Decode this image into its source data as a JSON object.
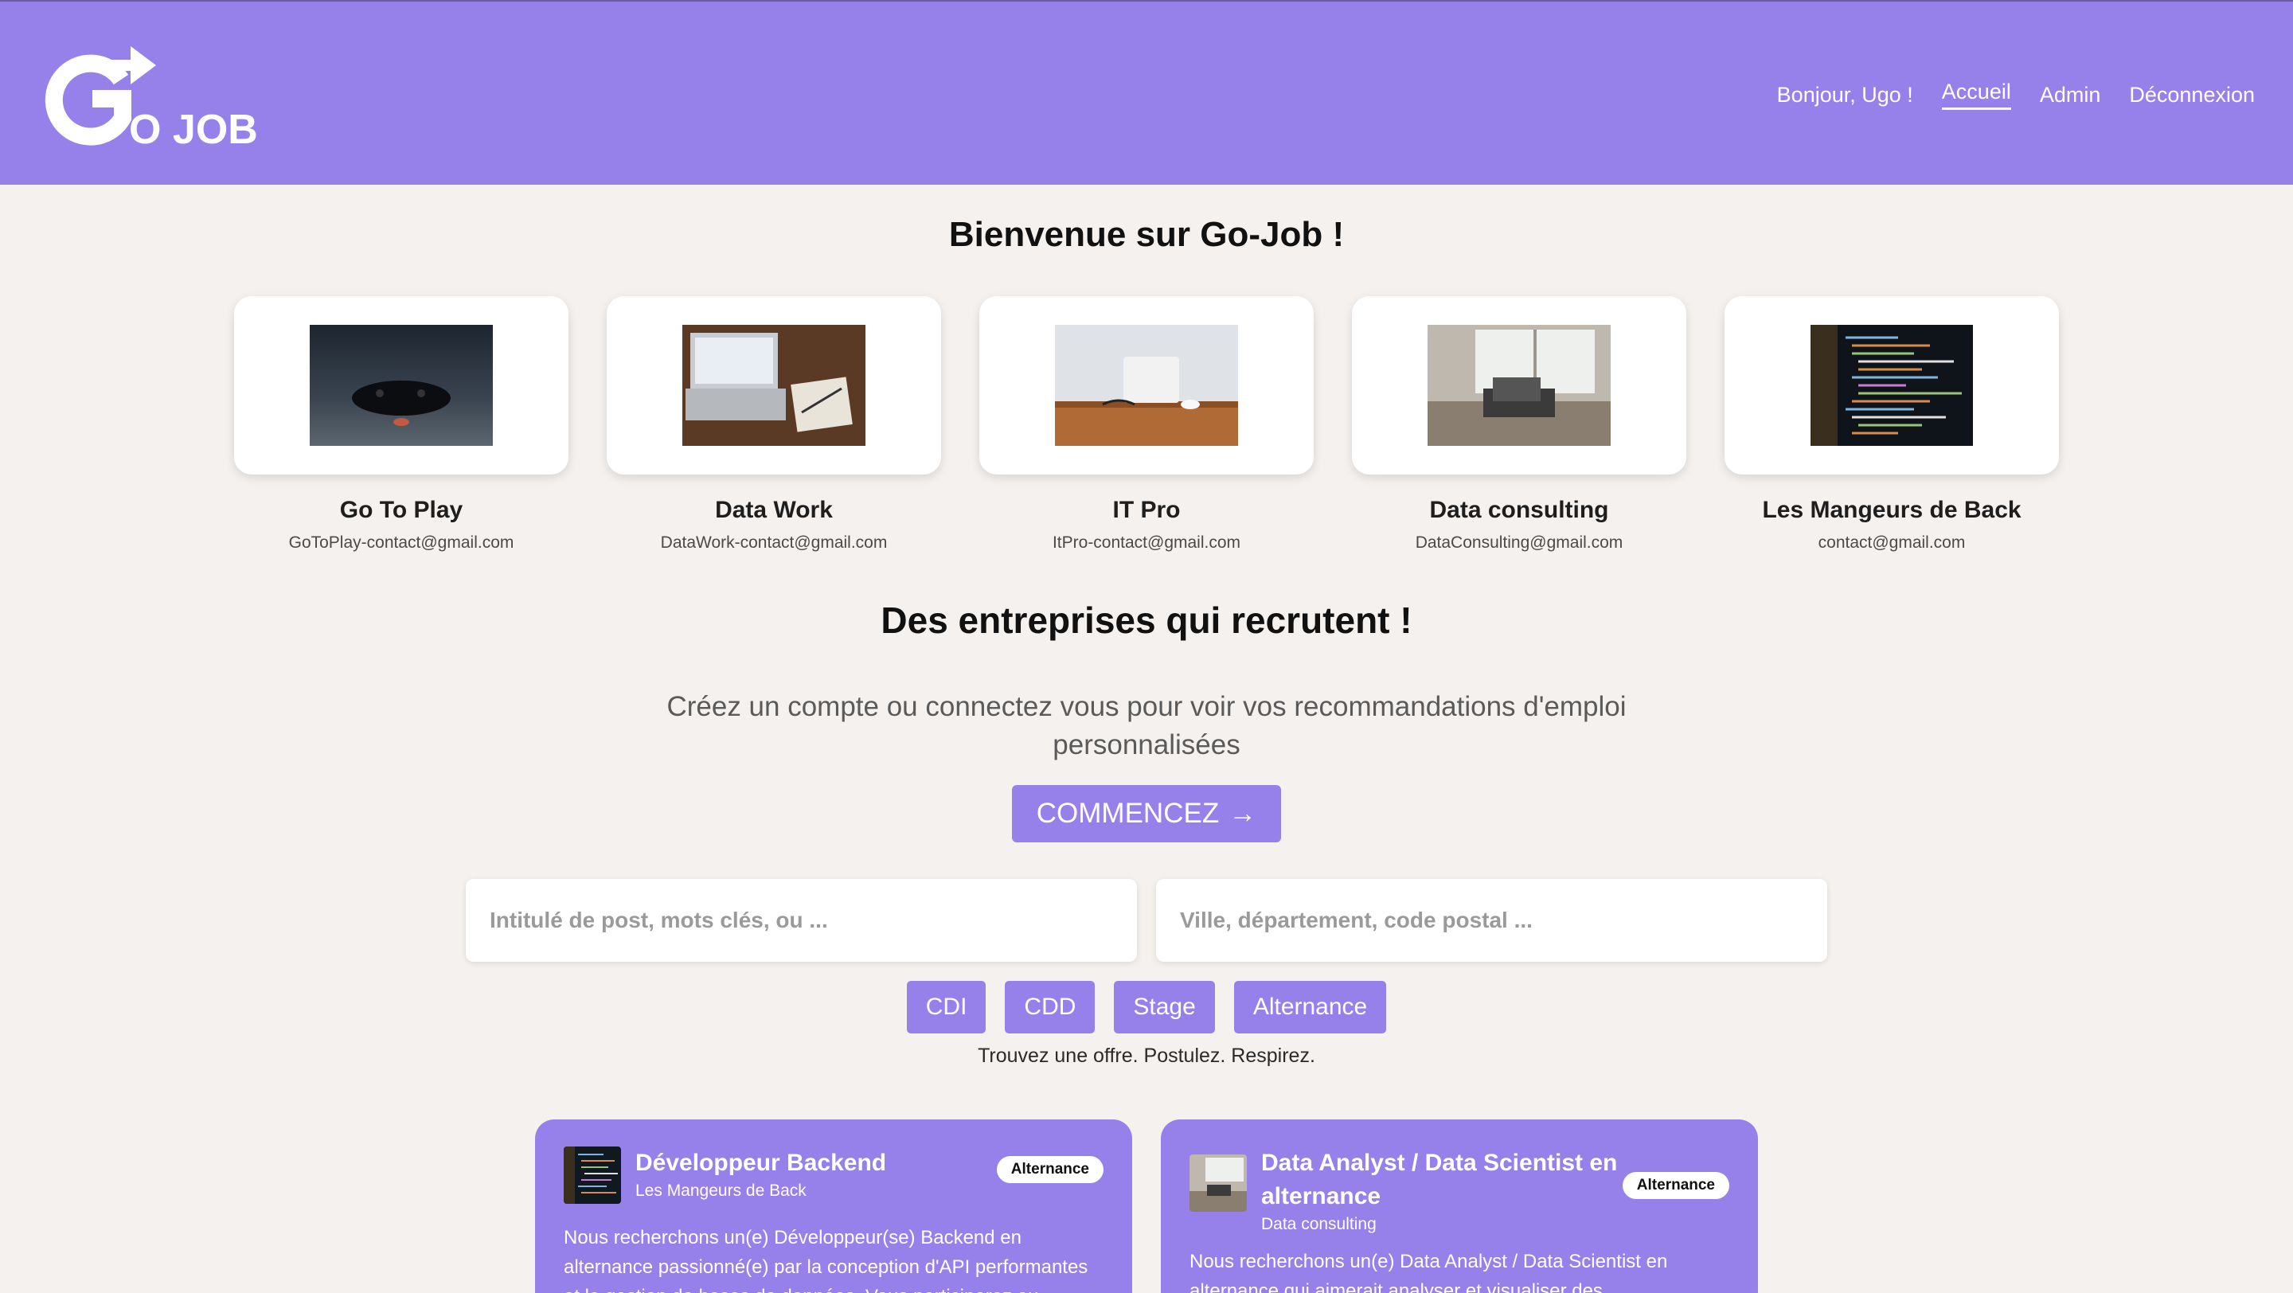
{
  "header": {
    "logo_text": "O JOB",
    "greeting": "Bonjour, Ugo !",
    "nav": {
      "home": "Accueil",
      "admin": "Admin",
      "logout": "Déconnexion"
    }
  },
  "welcome_title": "Bienvenue sur Go-Job !",
  "companies": [
    {
      "name": "Go To Play",
      "email": "GoToPlay-contact@gmail.com",
      "image": "gamepad-photo"
    },
    {
      "name": "Data Work",
      "email": "DataWork-contact@gmail.com",
      "image": "laptop-desk-photo"
    },
    {
      "name": "IT Pro",
      "email": "ItPro-contact@gmail.com",
      "image": "wood-desk-photo"
    },
    {
      "name": "Data consulting",
      "email": "DataConsulting@gmail.com",
      "image": "office-window-photo"
    },
    {
      "name": "Les Mangeurs de Back",
      "email": "contact@gmail.com",
      "image": "code-screen-photo"
    }
  ],
  "recruit_title": "Des entreprises qui recrutent !",
  "prompt": "Créez un compte ou connectez vous pour voir vos recommandations d'emploi personnalisées",
  "cta_label": "COMMENCEZ",
  "search": {
    "job_placeholder": "Intitulé de post, mots clés, ou ...",
    "location_placeholder": "Ville, département, code postal ..."
  },
  "filters": [
    "CDI",
    "CDD",
    "Stage",
    "Alternance"
  ],
  "tagline": "Trouvez une offre. Postulez. Respirez.",
  "jobs": [
    {
      "title": "Développeur Backend",
      "company": "Les Mangeurs de Back",
      "badge": "Alternance",
      "description": "Nous recherchons un(e) Développeur(se) Backend en alternance passionné(e) par la conception d'API performantes et la gestion de bases de données. Vous participerez au"
    },
    {
      "title": "Data Analyst / Data Scientist en alternance",
      "company": "Data consulting",
      "badge": "Alternance",
      "description": "Nous recherchons un(e) Data Analyst / Data Scientist en alternance qui aimerait analyser et visualiser des"
    }
  ],
  "colors": {
    "brand": "#9680ea",
    "background": "#f5f1ee"
  }
}
